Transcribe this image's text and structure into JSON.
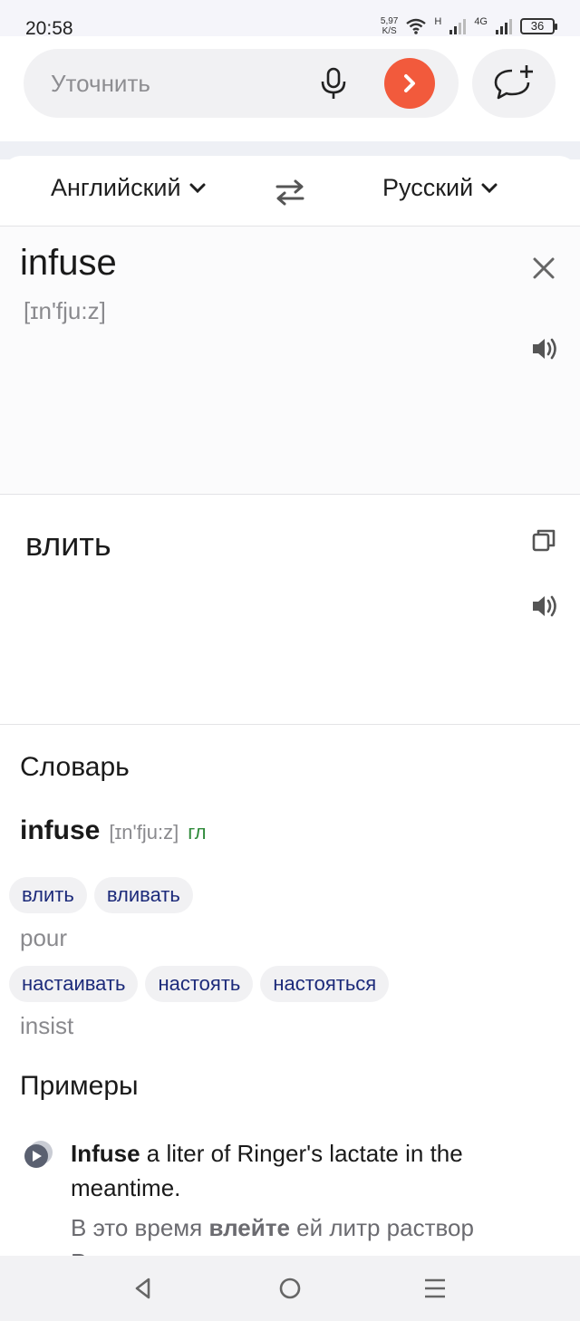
{
  "status_bar": {
    "time": "20:58",
    "net_speed_value": "5,97",
    "net_speed_unit": "K/S",
    "signal_1_label": "H",
    "signal_2_label": "4G",
    "battery": "36"
  },
  "search": {
    "placeholder": "Уточнить"
  },
  "languages": {
    "source": "Английский",
    "target": "Русский"
  },
  "source": {
    "word": "infuse",
    "transcription": "[ɪn'fju:z]"
  },
  "translation": {
    "word": "влить"
  },
  "dictionary": {
    "title": "Словарь",
    "word": "infuse",
    "transcription": "[ɪn'fju:z]",
    "pos": "гл",
    "groups": [
      {
        "chips": [
          "влить",
          "вливать"
        ],
        "back": "pour"
      },
      {
        "chips": [
          "настаивать",
          "настоять",
          "настояться"
        ],
        "back": "insist"
      }
    ]
  },
  "examples": {
    "title": "Примеры",
    "items": [
      {
        "source_bold": "Infuse",
        "source_rest": " a liter of Ringer's lactate in the meantime.",
        "target_pre": "В это время ",
        "target_bold": "влейте",
        "target_rest": " ей литр раствор Рингера."
      }
    ]
  },
  "colors": {
    "accent": "#f25a3c",
    "chip_text": "#1c2a7a",
    "pos_green": "#2f8a3a"
  }
}
